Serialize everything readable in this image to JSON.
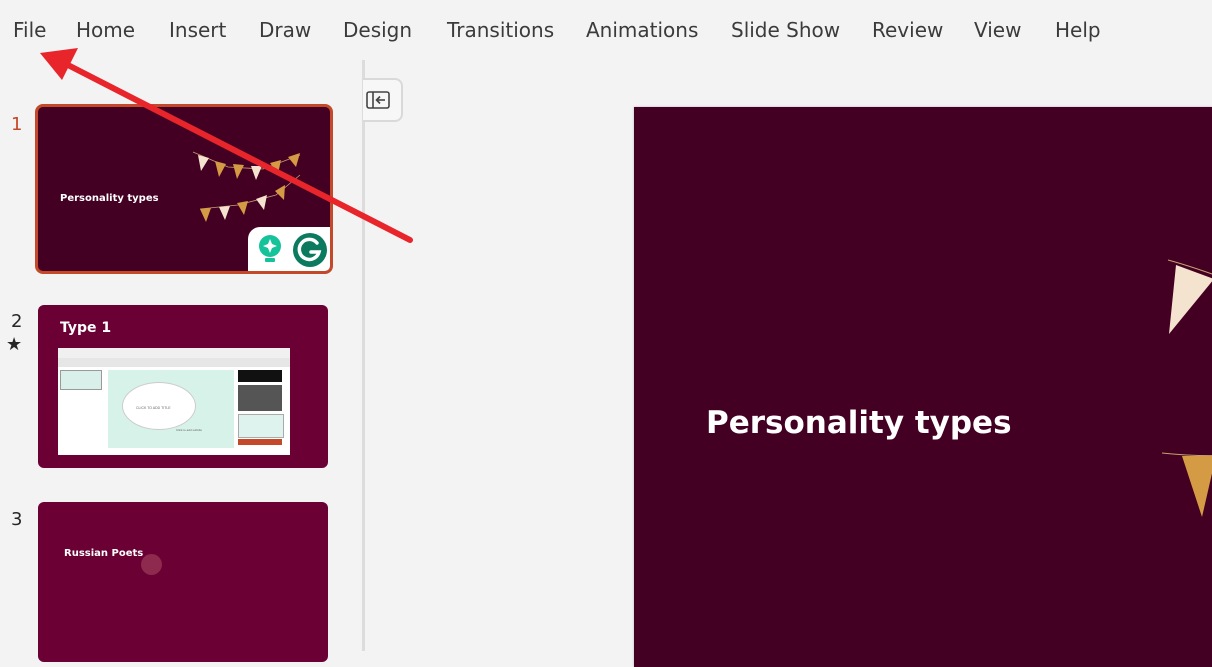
{
  "ribbon": {
    "tabs": [
      "File",
      "Home",
      "Insert",
      "Draw",
      "Design",
      "Transitions",
      "Animations",
      "Slide Show",
      "Review",
      "View",
      "Help"
    ]
  },
  "slides": [
    {
      "number": "1",
      "title": "Personality types"
    },
    {
      "number": "2",
      "title": "Type 1",
      "inner_title": "CLICK TO ADD TITLE",
      "inner_subtitle": "Click to add subtitle"
    },
    {
      "number": "3",
      "title": "Russian Poets"
    }
  ],
  "main_slide": {
    "title": "Personality types"
  },
  "colors": {
    "selected_slide_bg": "#430022",
    "slide_bg": "#6a0034",
    "accent": "#c4492b",
    "annotation_arrow": "#e8252a",
    "pennant_cream": "#f4e4cf",
    "pennant_gold": "#d49a44",
    "grammarly_green": "#15c39a"
  },
  "icons": {
    "collapse": "panel-collapse-icon",
    "grammarly": "grammarly-icon",
    "suggest": "lightbulb-icon",
    "animation": "star-icon"
  }
}
